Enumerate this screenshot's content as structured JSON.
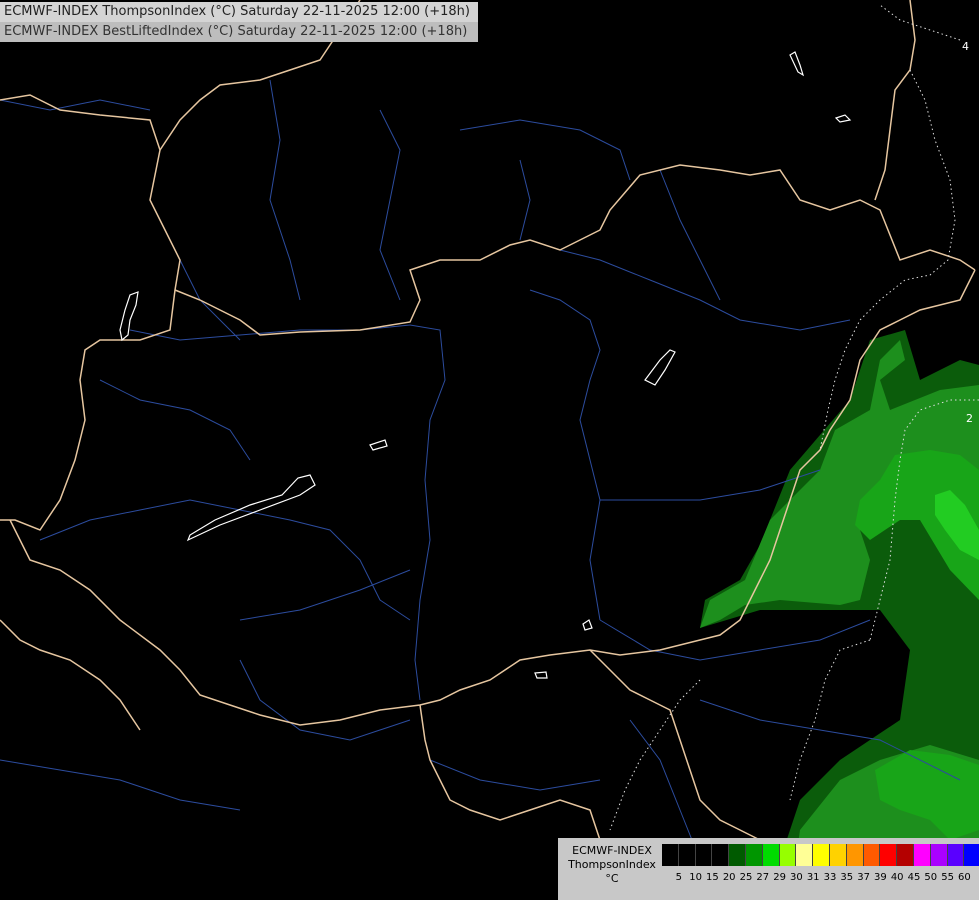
{
  "title": {
    "line1": "ECMWF-INDEX ThompsonIndex (°C) Saturday 22-11-2025 12:00 (+18h)",
    "line2": "ECMWF-INDEX BestLiftedIndex (°C) Saturday 22-11-2025 12:00 (+18h)"
  },
  "contour_labels": [
    "4",
    "2"
  ],
  "legend": {
    "line1": "ECMWF-INDEX",
    "line2": "ThompsonIndex",
    "unit": "°C",
    "ticks": [
      "5",
      "10",
      "15",
      "20",
      "25",
      "27",
      "29",
      "30",
      "31",
      "33",
      "35",
      "37",
      "39",
      "40",
      "45",
      "50",
      "55",
      "60"
    ],
    "colors": [
      "#000000",
      "#000000",
      "#000000",
      "#000000",
      "#005a00",
      "#009600",
      "#00dc00",
      "#96ff00",
      "#ffff96",
      "#ffff00",
      "#ffd200",
      "#ff9600",
      "#ff5a00",
      "#ff0000",
      "#b40000",
      "#ff00ff",
      "#aa00ff",
      "#5a00ff",
      "#0000ff"
    ]
  },
  "colors": {
    "background": "#000000",
    "border": "#e8c8a0",
    "river": "#2a4a9a",
    "lake": "#ffffff",
    "dark_green": "#0a5a0a",
    "mid_green": "#1a8a1a",
    "bright_green": "#22cc22"
  }
}
